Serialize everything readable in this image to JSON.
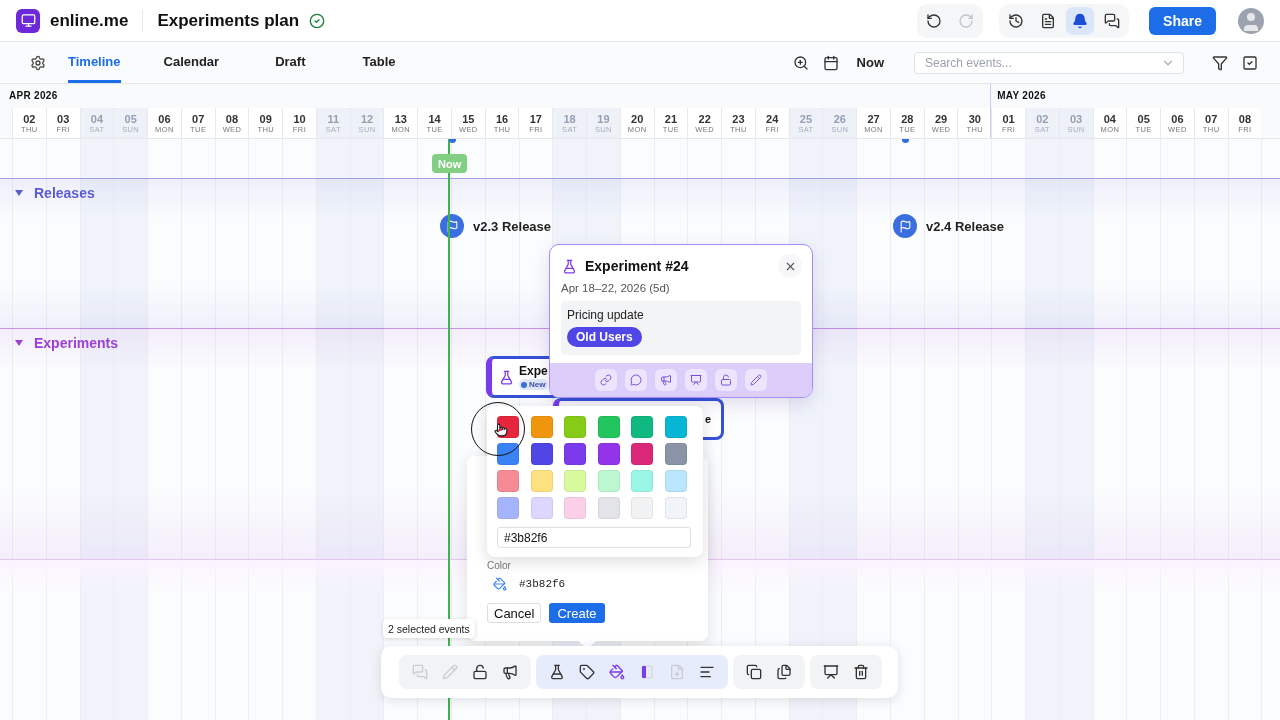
{
  "header": {
    "app_name": "enline.me",
    "title": "Experiments plan",
    "saved": true,
    "history": [
      {
        "disabled": false
      },
      {
        "disabled": true
      }
    ],
    "tools": [
      {
        "selected": false
      },
      {
        "selected": false
      },
      {
        "selected": true
      },
      {
        "selected": false
      }
    ],
    "share": "Share"
  },
  "tabs": [
    {
      "label": "Timeline",
      "selected": true
    },
    {
      "label": "Calendar",
      "selected": false
    },
    {
      "label": "Draft",
      "selected": false
    },
    {
      "label": "Table",
      "selected": false
    }
  ],
  "view_controls": {
    "now": "Now",
    "search": {
      "placeholder": "Search events..."
    }
  },
  "months": [
    {
      "label": "APR 2026",
      "days": [
        {
          "day": "02",
          "weekday": "THU",
          "weekend": false
        },
        {
          "day": "03",
          "weekday": "FRI",
          "weekend": false
        },
        {
          "day": "04",
          "weekday": "SAT",
          "weekend": true
        },
        {
          "day": "05",
          "weekday": "SUN",
          "weekend": true
        },
        {
          "day": "06",
          "weekday": "MON",
          "weekend": false
        },
        {
          "day": "07",
          "weekday": "TUE",
          "weekend": false
        },
        {
          "day": "08",
          "weekday": "WED",
          "weekend": false
        },
        {
          "day": "09",
          "weekday": "THU",
          "weekend": false
        },
        {
          "day": "10",
          "weekday": "FRI",
          "weekend": false
        },
        {
          "day": "11",
          "weekday": "SAT",
          "weekend": true
        },
        {
          "day": "12",
          "weekday": "SUN",
          "weekend": true
        },
        {
          "day": "13",
          "weekday": "MON",
          "weekend": false
        },
        {
          "day": "14",
          "weekday": "TUE",
          "weekend": false
        },
        {
          "day": "15",
          "weekday": "WED",
          "weekend": false
        },
        {
          "day": "16",
          "weekday": "THU",
          "weekend": false
        },
        {
          "day": "17",
          "weekday": "FRI",
          "weekend": false
        },
        {
          "day": "18",
          "weekday": "SAT",
          "weekend": true
        },
        {
          "day": "19",
          "weekday": "SUN",
          "weekend": true
        },
        {
          "day": "20",
          "weekday": "MON",
          "weekend": false
        },
        {
          "day": "21",
          "weekday": "TUE",
          "weekend": false
        },
        {
          "day": "22",
          "weekday": "WED",
          "weekend": false
        },
        {
          "day": "23",
          "weekday": "THU",
          "weekend": false
        },
        {
          "day": "24",
          "weekday": "FRI",
          "weekend": false
        },
        {
          "day": "25",
          "weekday": "SAT",
          "weekend": true
        },
        {
          "day": "26",
          "weekday": "SUN",
          "weekend": true
        },
        {
          "day": "27",
          "weekday": "MON",
          "weekend": false
        },
        {
          "day": "28",
          "weekday": "TUE",
          "weekend": false
        },
        {
          "day": "29",
          "weekday": "WED",
          "weekend": false
        },
        {
          "day": "30",
          "weekday": "THU",
          "weekend": false
        }
      ]
    },
    {
      "label": "MAY 2026",
      "days": [
        {
          "day": "01",
          "weekday": "FRI",
          "weekend": false
        },
        {
          "day": "02",
          "weekday": "SAT",
          "weekend": true
        },
        {
          "day": "03",
          "weekday": "SUN",
          "weekend": true
        },
        {
          "day": "04",
          "weekday": "MON",
          "weekend": false
        },
        {
          "day": "05",
          "weekday": "TUE",
          "weekend": false
        },
        {
          "day": "06",
          "weekday": "WED",
          "weekend": false
        },
        {
          "day": "07",
          "weekday": "THU",
          "weekend": false
        },
        {
          "day": "08",
          "weekday": "FRI",
          "weekend": false
        }
      ]
    }
  ],
  "now_badge": "Now",
  "sections": [
    {
      "title": "Releases",
      "expanded": true,
      "color": "#5b5bd6",
      "events": [
        {
          "label": "v2.3 Release"
        },
        {
          "label": "v2.4 Release"
        }
      ]
    },
    {
      "title": "Experiments",
      "expanded": true,
      "color": "#9b3fd6",
      "cards": [
        {
          "title": "Expe",
          "badge": "New"
        },
        {
          "title": "e"
        }
      ]
    }
  ],
  "event_popover": {
    "title": "Experiment #24",
    "dates": "Apr 18–22, 2026 (5d)",
    "description": "Pricing update",
    "tag": "Old Users"
  },
  "create_dialog": {
    "color_label": "Color",
    "color_value": "#3b82f6",
    "cancel": "Cancel",
    "create": "Create"
  },
  "color_palette": {
    "swatches": [
      {
        "color": "#e5263d"
      },
      {
        "color": "#f0960e"
      },
      {
        "color": "#84cc16"
      },
      {
        "color": "#22c55e"
      },
      {
        "color": "#10b981"
      },
      {
        "color": "#06b6d4"
      },
      {
        "color": "#3b82f6"
      },
      {
        "color": "#4f46e5"
      },
      {
        "color": "#7c3aed"
      },
      {
        "color": "#9333ea"
      },
      {
        "color": "#db2777"
      },
      {
        "color": "#8a94a6"
      },
      {
        "color": "#f68b96"
      },
      {
        "color": "#fde080"
      },
      {
        "color": "#d9f99d"
      },
      {
        "color": "#bbf7d0"
      },
      {
        "color": "#99f6e4"
      },
      {
        "color": "#bae6fd"
      },
      {
        "color": "#a5b4fc"
      },
      {
        "color": "#ddd6fe"
      },
      {
        "color": "#fbcfe8"
      },
      {
        "color": "#e2e4e7"
      },
      {
        "color": "#f1f2f4"
      },
      {
        "color": "#f1f4f8"
      }
    ],
    "hex_value": "#3b82f6"
  },
  "selection_tooltip": "2 selected events",
  "toolbar": {
    "groups": [
      [
        {
          "disabled": true,
          "active": false
        },
        {
          "disabled": true,
          "active": false
        },
        {
          "disabled": false,
          "active": false
        },
        {
          "disabled": false,
          "active": false
        }
      ],
      [
        {
          "disabled": false,
          "active": false
        },
        {
          "disabled": false,
          "active": false
        },
        {
          "disabled": false,
          "active": true
        },
        {
          "disabled": false,
          "active": true
        },
        {
          "disabled": true,
          "active": false
        },
        {
          "disabled": false,
          "active": false
        }
      ],
      [
        {
          "disabled": false,
          "active": false
        },
        {
          "disabled": false,
          "active": false
        }
      ],
      [
        {
          "disabled": false,
          "active": false
        },
        {
          "disabled": false,
          "active": false
        }
      ]
    ]
  }
}
